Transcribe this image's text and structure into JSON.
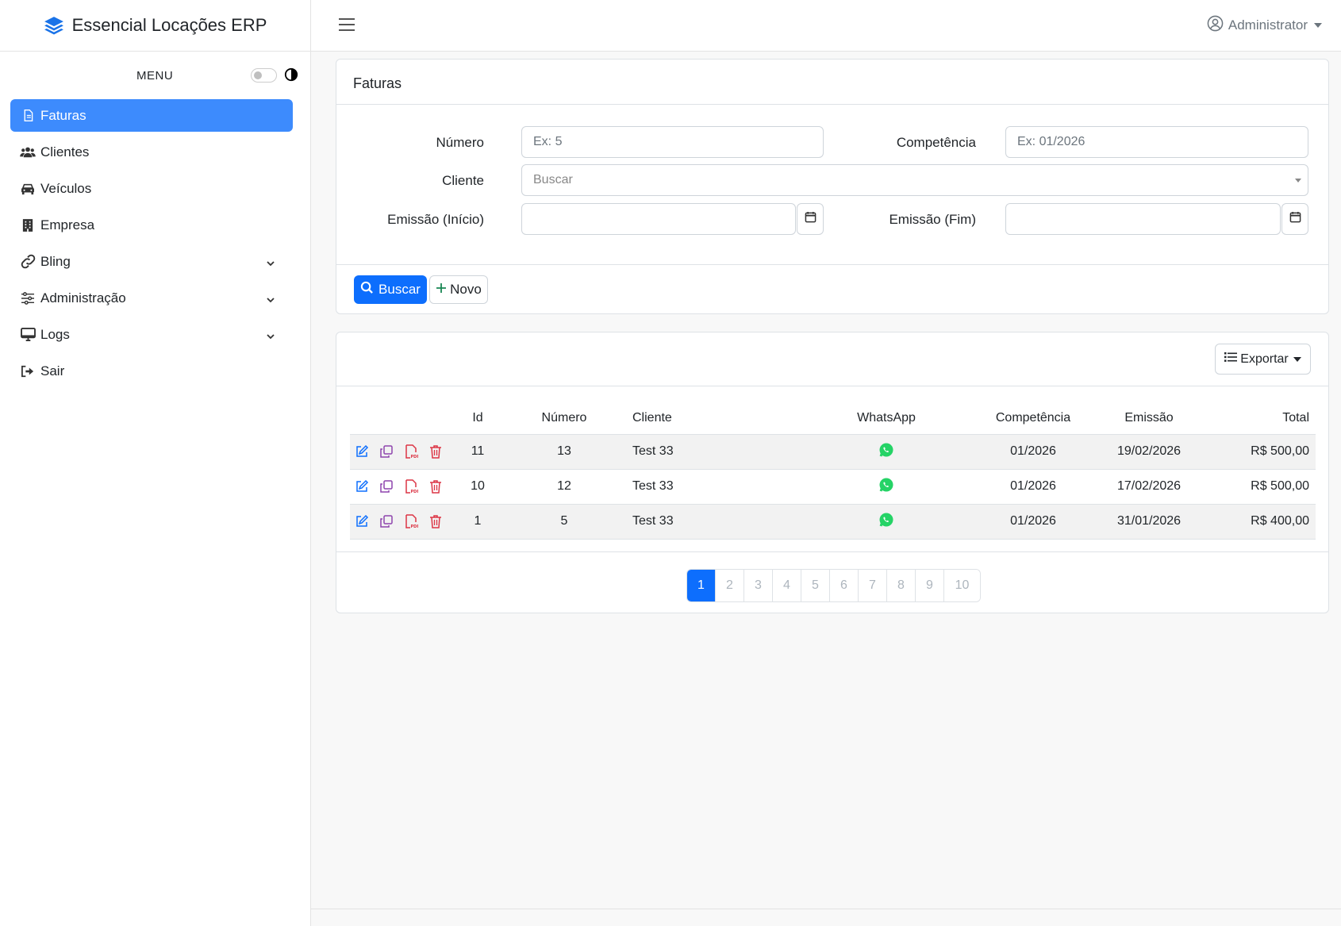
{
  "app": {
    "title": "Essencial Locações ERP"
  },
  "sidebar": {
    "menu_title": "MENU",
    "items": [
      {
        "label": "Faturas",
        "icon": "file-icon",
        "active": true
      },
      {
        "label": "Clientes",
        "icon": "users-icon"
      },
      {
        "label": "Veículos",
        "icon": "car-icon"
      },
      {
        "label": "Empresa",
        "icon": "building-icon"
      },
      {
        "label": "Bling",
        "icon": "link-icon",
        "expandable": true
      },
      {
        "label": "Administração",
        "icon": "sliders-icon",
        "expandable": true
      },
      {
        "label": "Logs",
        "icon": "monitor-icon",
        "expandable": true
      },
      {
        "label": "Sair",
        "icon": "sign-out-icon"
      }
    ]
  },
  "header": {
    "user": "Administrator"
  },
  "filters": {
    "card_title": "Faturas",
    "numero_label": "Número",
    "numero_placeholder": "Ex: 5",
    "competencia_label": "Competência",
    "competencia_placeholder": "Ex: 01/2026",
    "cliente_label": "Cliente",
    "cliente_placeholder": "Buscar",
    "emissao_inicio_label": "Emissão (Início)",
    "emissao_fim_label": "Emissão (Fim)",
    "search_button": "Buscar",
    "new_button": "Novo"
  },
  "results": {
    "export_button": "Exportar",
    "columns": [
      "Id",
      "Número",
      "Cliente",
      "WhatsApp",
      "Competência",
      "Emissão",
      "Total"
    ],
    "rows": [
      {
        "id": "11",
        "numero": "13",
        "cliente": "Test 33",
        "competencia": "01/2026",
        "emissao": "19/02/2026",
        "total": "R$ 500,00"
      },
      {
        "id": "10",
        "numero": "12",
        "cliente": "Test 33",
        "competencia": "01/2026",
        "emissao": "17/02/2026",
        "total": "R$ 500,00"
      },
      {
        "id": "1",
        "numero": "5",
        "cliente": "Test 33",
        "competencia": "01/2026",
        "emissao": "31/01/2026",
        "total": "R$ 400,00"
      }
    ],
    "pages": [
      "1",
      "2",
      "3",
      "4",
      "5",
      "6",
      "7",
      "8",
      "9",
      "10"
    ],
    "current_page": "1"
  },
  "colors": {
    "primary": "#0d6efd",
    "sidebar_active": "#3d8bfd",
    "whatsapp": "#25d366",
    "edit": "#0d6efd",
    "copy": "#8e44ad",
    "pdf": "#dc3545",
    "delete": "#dc3545"
  }
}
